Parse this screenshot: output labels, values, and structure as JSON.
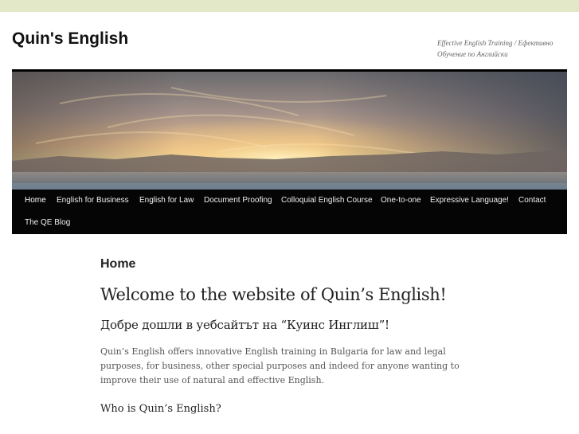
{
  "site": {
    "title": "Quin's English",
    "tagline": "Effective English Training / Ефективно Обучение по Английски"
  },
  "banner": {
    "alt": ""
  },
  "nav": {
    "items": [
      {
        "label": "Home",
        "active": true
      },
      {
        "label": "English for Business"
      },
      {
        "label": "English for Law"
      },
      {
        "label": "Document Proofing"
      },
      {
        "label": "Colloquial English Course"
      },
      {
        "label": "One-to-one"
      },
      {
        "label": "Expressive Language!"
      },
      {
        "label": "Contact"
      },
      {
        "label": "The QE Blog"
      }
    ]
  },
  "main": {
    "page_title": "Home",
    "welcome_en": "Welcome to the website of Quin’s English!",
    "welcome_bg": "Добре дошли в уебсайтът на “Куинс Инглиш”!",
    "intro": "Quin’s English offers innovative English training in Bulgaria for law and legal purposes, for business, other special purposes and indeed for anyone wanting to improve their use of natural and effective English.",
    "who_heading": "Who is Quin’s English?"
  },
  "colors": {
    "outer_background": "#e3e9c8",
    "nav_background": "#050505",
    "text": "#222222"
  }
}
